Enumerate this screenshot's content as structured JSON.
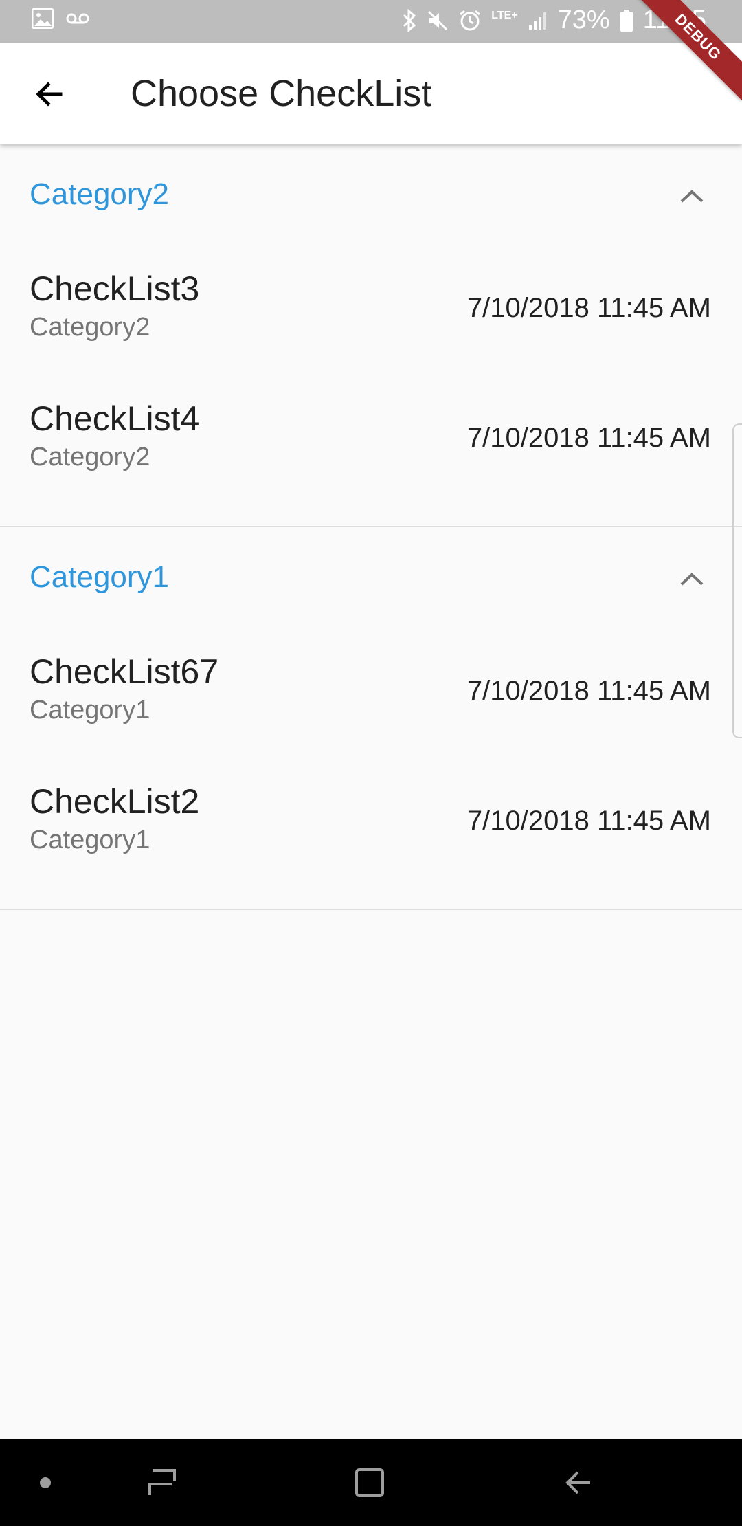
{
  "status_bar": {
    "battery_percent": "73%",
    "time": "11:45",
    "network": "LTE+",
    "icons": [
      "gallery-icon",
      "voicemail-icon",
      "bluetooth-icon",
      "mute-icon",
      "alarm-icon",
      "signal-icon",
      "battery-icon"
    ]
  },
  "debug_banner": "DEBUG",
  "app_bar": {
    "back_icon": "arrow-back-icon",
    "title": "Choose CheckList"
  },
  "colors": {
    "accent": "#2f96dc",
    "debug": "#a3282a",
    "status_bar": "#bdbdbd"
  },
  "sections": [
    {
      "title": "Category2",
      "expanded": true,
      "items": [
        {
          "title": "CheckList3",
          "subtitle": "Category2",
          "date": "7/10/2018 11:45 AM"
        },
        {
          "title": "CheckList4",
          "subtitle": "Category2",
          "date": "7/10/2018 11:45 AM"
        }
      ]
    },
    {
      "title": "Category1",
      "expanded": true,
      "items": [
        {
          "title": "CheckList67",
          "subtitle": "Category1",
          "date": "7/10/2018 11:45 AM"
        },
        {
          "title": "CheckList2",
          "subtitle": "Category1",
          "date": "7/10/2018 11:45 AM"
        }
      ]
    }
  ],
  "nav_bar": {
    "icons": [
      "dot-icon",
      "recents-icon",
      "home-icon",
      "back-nav-icon"
    ]
  }
}
